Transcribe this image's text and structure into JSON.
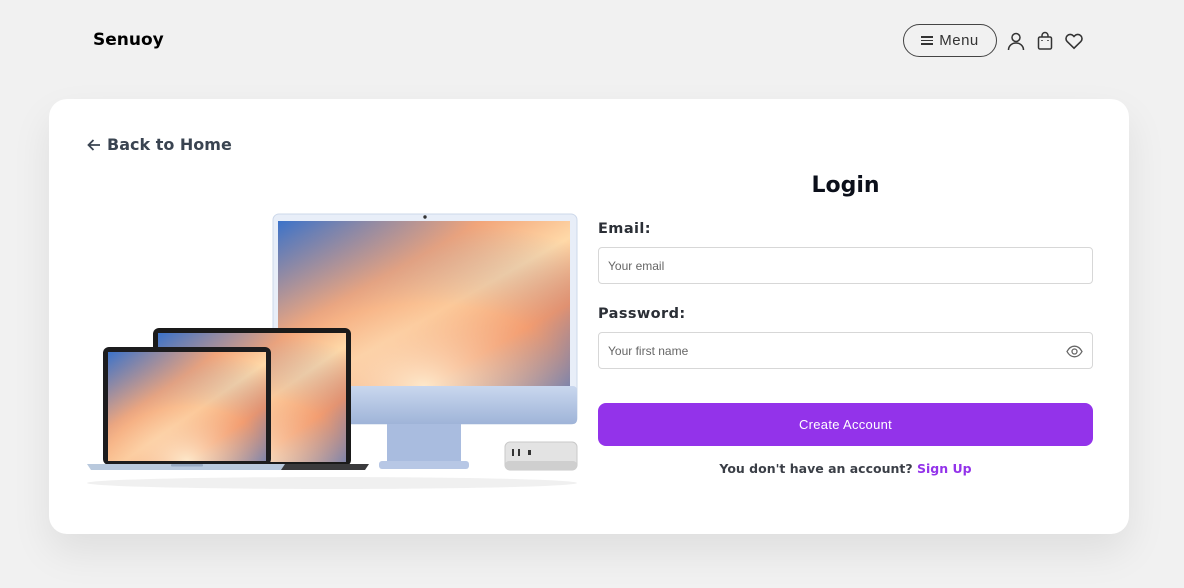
{
  "header": {
    "brand": "Senuoy",
    "menu_label": "Menu",
    "icons": [
      "menu-lines-icon",
      "user-icon",
      "shopping-bag-icon",
      "heart-icon"
    ]
  },
  "card": {
    "back_label": "Back to Home",
    "title": "Login",
    "email": {
      "label": "Email:",
      "placeholder": "Your email",
      "value": ""
    },
    "password": {
      "label": "Password:",
      "placeholder": "Your first name",
      "value": ""
    },
    "submit_label": "Create Account",
    "signup_prompt": "You don't have an account?",
    "signup_link": "Sign Up"
  },
  "colors": {
    "accent": "#9333ea",
    "page_bg": "#f1f1f1",
    "card_bg": "#ffffff"
  }
}
